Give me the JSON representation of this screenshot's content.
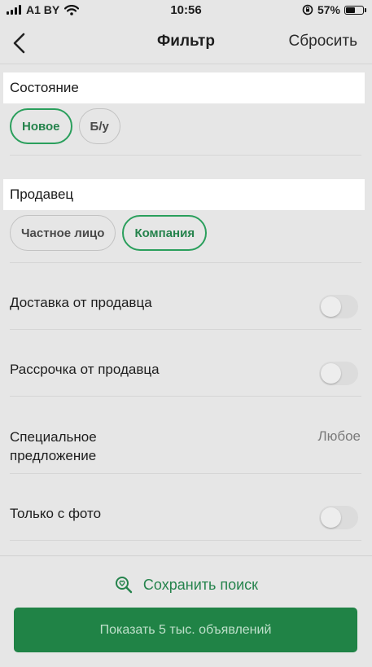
{
  "status_bar": {
    "carrier": "A1 BY",
    "time": "10:56",
    "battery_percent": "57%",
    "battery_level": 0.57,
    "icons": [
      "signal-icon",
      "wifi-icon",
      "orientation-lock-icon",
      "battery-icon"
    ]
  },
  "nav": {
    "back_icon": "chevron-left-icon",
    "title": "Фильтр",
    "reset_label": "Сбросить"
  },
  "condition": {
    "header": "Состояние",
    "chips": [
      {
        "label": "Новое",
        "selected": true
      },
      {
        "label": "Б/у",
        "selected": false
      }
    ]
  },
  "seller": {
    "header": "Продавец",
    "chips": [
      {
        "label": "Частное лицо",
        "selected": false
      },
      {
        "label": "Компания",
        "selected": true
      }
    ]
  },
  "options": [
    {
      "label": "Доставка от продавца",
      "type": "toggle",
      "on": false
    },
    {
      "label": "Рассрочка от продавца",
      "type": "toggle",
      "on": false
    },
    {
      "label_line1": "Специальное",
      "label_line2": "предложение",
      "value": "Любое",
      "type": "select"
    },
    {
      "label": "Только с фото",
      "type": "toggle",
      "on": false
    }
  ],
  "footer": {
    "save_search_icon": "heart-search-icon",
    "save_search_label": "Сохранить поиск",
    "show_button_label": "Показать 5 тыс. объявлений"
  },
  "colors": {
    "accent": "#25834c",
    "button_bg": "#208346",
    "background": "#e6e6e6"
  }
}
